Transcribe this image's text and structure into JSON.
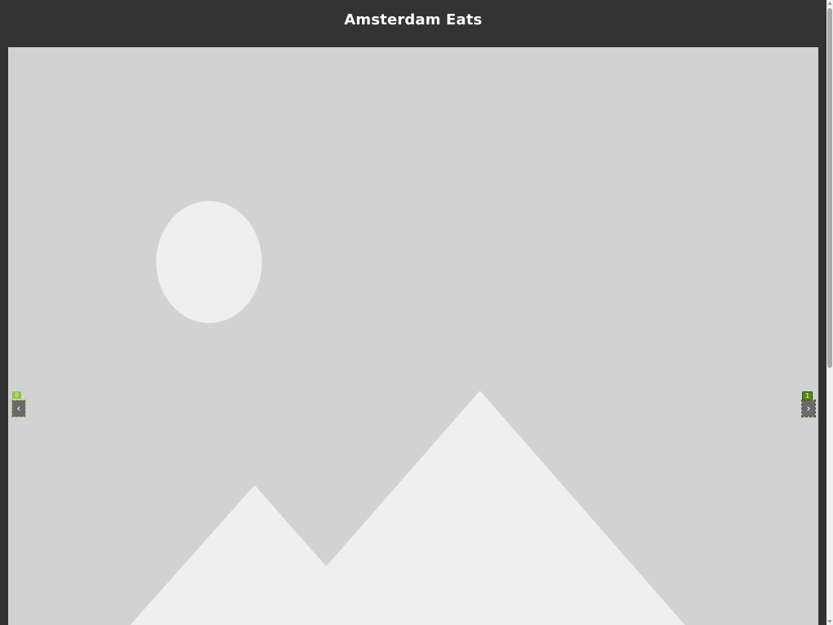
{
  "header": {
    "title": "Amsterdam Eats"
  },
  "carousel": {
    "image_icon": "image-placeholder-icon",
    "prev": {
      "badge": "0",
      "label": "‹",
      "icon": "chevron-left-icon"
    },
    "next": {
      "badge": "1",
      "label": "›",
      "icon": "chevron-right-icon"
    }
  },
  "colors": {
    "page_background": "#333333",
    "title_text": "#ffffff",
    "placeholder_background": "#d2d2d2",
    "placeholder_shapes": "#efefef",
    "nav_button": "#6a6a6a"
  },
  "scrollbar": {
    "icon_up": "scroll-up-arrow-icon",
    "icon_down": "scroll-down-arrow-icon"
  }
}
